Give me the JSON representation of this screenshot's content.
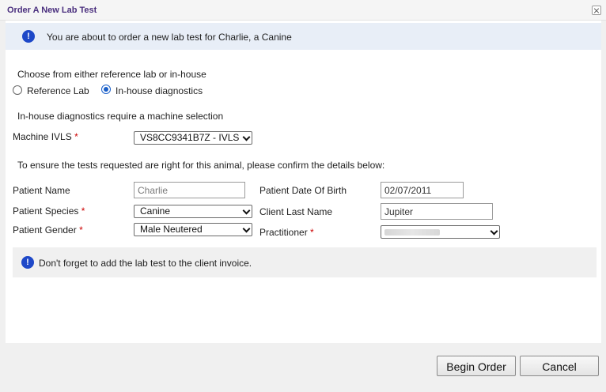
{
  "dialog": {
    "title": "Order A New Lab Test",
    "info_banner": "You are about to order a new lab test for Charlie, a Canine"
  },
  "lab_choice": {
    "prompt": "Choose from either reference lab or in-house",
    "options": [
      {
        "label": "Reference Lab",
        "checked": false
      },
      {
        "label": "In-house diagnostics",
        "checked": true
      }
    ],
    "machine_note": "In-house diagnostics require a machine selection"
  },
  "machine": {
    "label": "Machine IVLS",
    "required_mark": "*",
    "value": "VS8CC9341B7Z - IVLS"
  },
  "confirm_text": "To ensure the tests requested are right for this animal, please confirm the details below:",
  "patient": {
    "name_label": "Patient Name",
    "name_value": "Charlie",
    "species_label": "Patient Species",
    "species_value": "Canine",
    "gender_label": "Patient Gender",
    "gender_value": "Male Neutered",
    "dob_label": "Patient Date Of Birth",
    "dob_value": "02/07/2011",
    "client_label": "Client Last Name",
    "client_value": "Jupiter",
    "practitioner_label": "Practitioner",
    "practitioner_value": "",
    "required_mark": "*"
  },
  "note_banner": "Don't forget to add the lab test to the client invoice.",
  "icons": {
    "info": "info-icon",
    "close": "close-icon",
    "chevron": "chevron-down-icon"
  },
  "footer": {
    "begin_label": "Begin Order",
    "cancel_label": "Cancel"
  }
}
